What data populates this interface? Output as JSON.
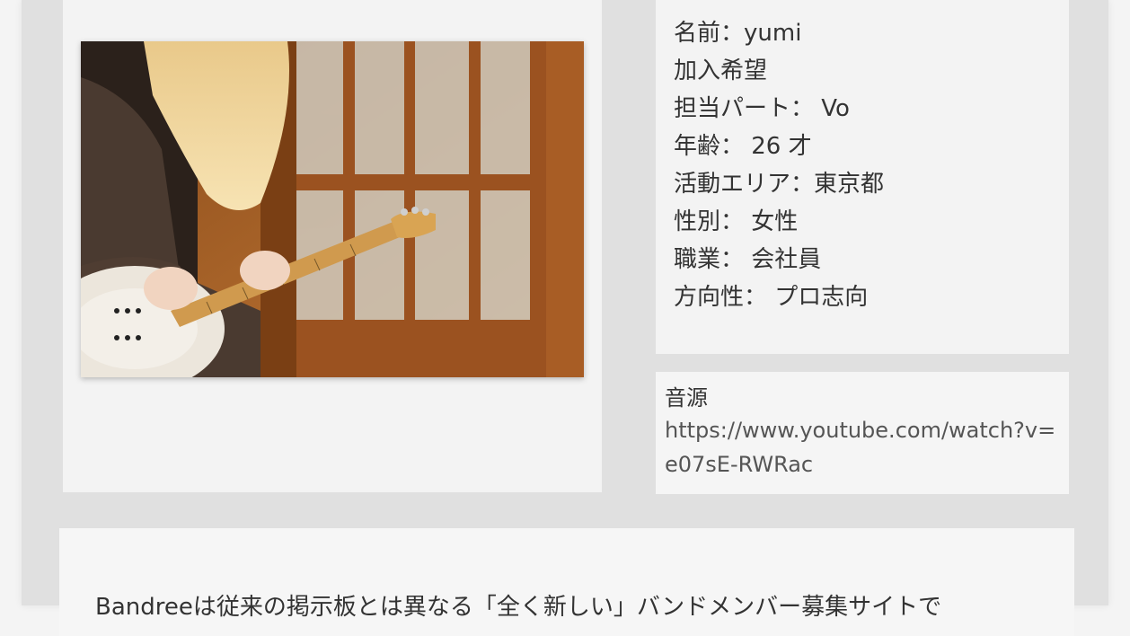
{
  "profile_photo": {
    "icon": "guitarist-photo",
    "colors": {
      "wood": "#b5692a",
      "dark_wood": "#7a3f14",
      "glass": "#c9c4b8",
      "hair": "#f2d79a",
      "sweater": "#4a3a30"
    }
  },
  "profile": {
    "name_line": "名前：yumi",
    "status_line": "加入希望",
    "part_line": "担当パート： Vo",
    "age_line": "年齢： 26 才",
    "area_line": "活動エリア：東京都",
    "gender_line": "性別： 女性",
    "job_line": "職業： 会社員",
    "direction_line": "方向性： プロ志向"
  },
  "audio": {
    "label": "音源",
    "url": "https://www.youtube.com/watch?v=e07sE-RWRac"
  },
  "intro": {
    "text": "Bandreeは従来の掲示板とは異なる「全く新しい」バンドメンバー募集サイトで"
  },
  "colors": {
    "page_bg": "#f4f4f4",
    "wrap_bg": "#e0e0e0",
    "card_bg": "#f3f3f3",
    "text": "#333333",
    "link": "#555555"
  }
}
